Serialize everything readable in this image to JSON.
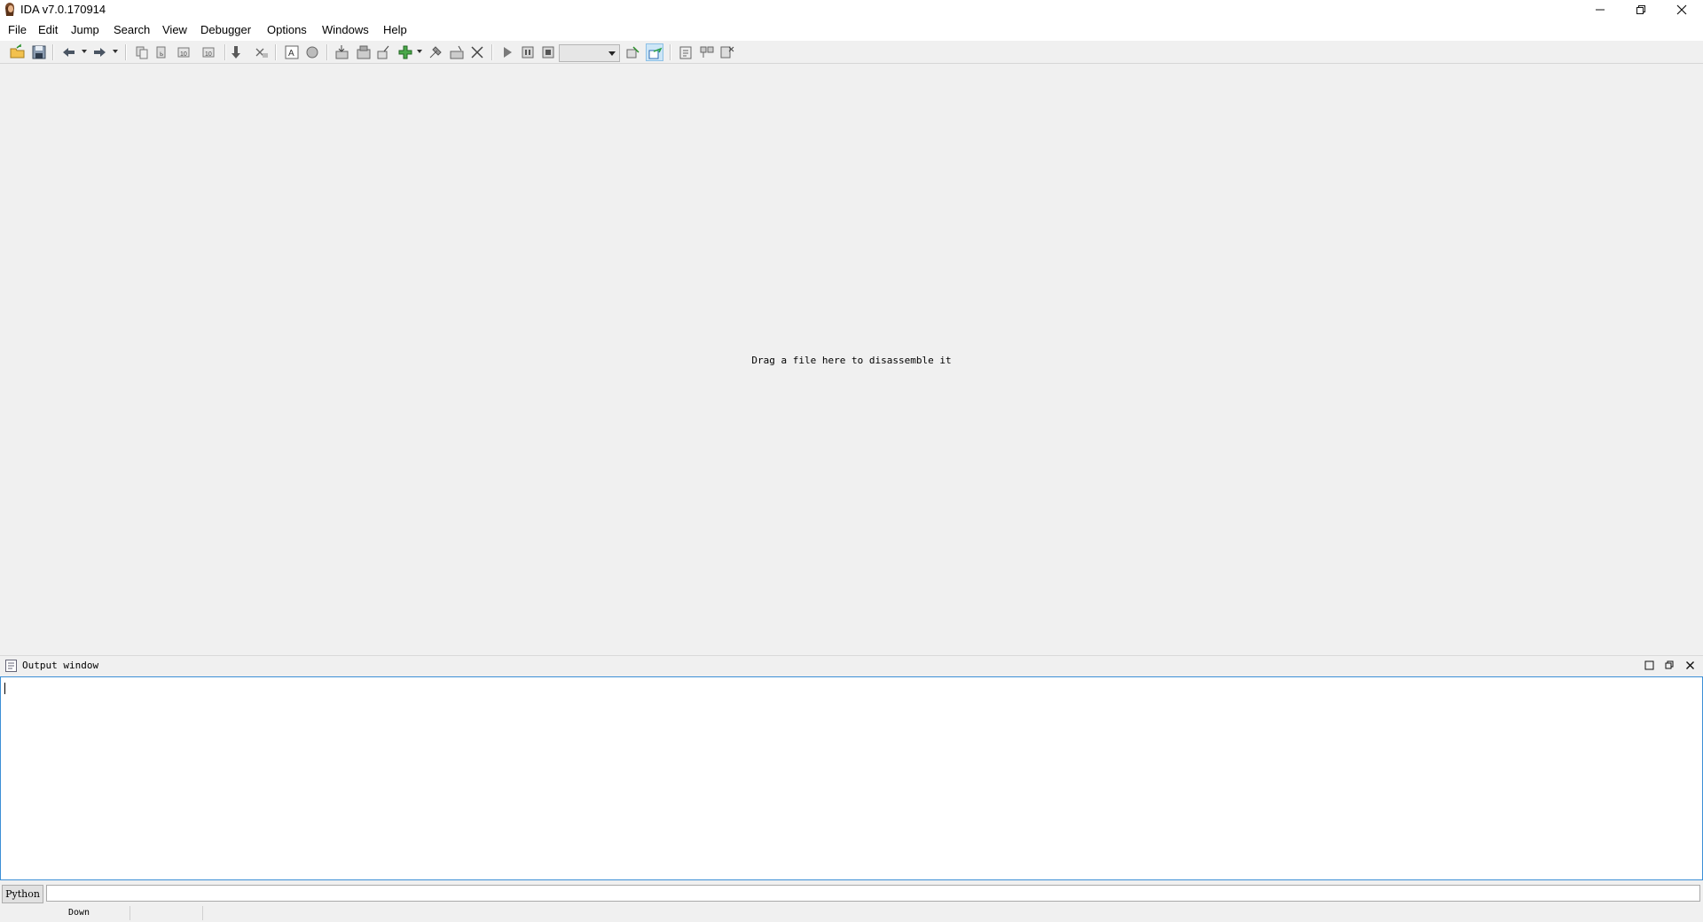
{
  "window": {
    "title": "IDA v7.0.170914"
  },
  "menu": {
    "items": [
      "File",
      "Edit",
      "Jump",
      "Search",
      "View",
      "Debugger",
      "Options",
      "Windows",
      "Help"
    ]
  },
  "toolbar": {
    "icons": [
      "open-icon",
      "save-icon",
      "back-icon",
      "forward-icon",
      "copy-icon",
      "paste-icon",
      "undo-icon",
      "redo-icon",
      "down-arrow-icon",
      "select-icon",
      "text-icon",
      "circle-icon",
      "patch-icon",
      "segment-icon",
      "graph-icon",
      "plugin-icon",
      "hammer-icon",
      "analyze-icon",
      "close-icon",
      "play-icon",
      "pause-icon",
      "stop-icon",
      "debug-attach-icon",
      "step-icon",
      "strings-icon",
      "structs-icon",
      "enums-icon"
    ],
    "debugger_select_value": ""
  },
  "main": {
    "hint": "Drag a file here to disassemble it"
  },
  "output": {
    "title": "Output window",
    "content": ""
  },
  "cli": {
    "language": "Python",
    "value": ""
  },
  "status": {
    "direction": "Down"
  }
}
